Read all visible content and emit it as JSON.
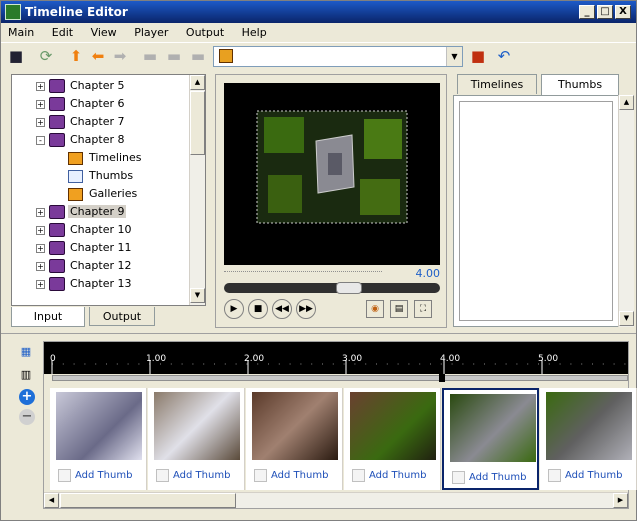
{
  "window": {
    "title": "Timeline Editor",
    "min": "_",
    "max": "□",
    "close": "X"
  },
  "menu": [
    "Main",
    "Edit",
    "View",
    "Player",
    "Output",
    "Help"
  ],
  "tree": {
    "items": [
      {
        "label": "Chapter 5",
        "kind": "chapter",
        "expand": "+"
      },
      {
        "label": "Chapter 6",
        "kind": "chapter",
        "expand": "+"
      },
      {
        "label": "Chapter 7",
        "kind": "chapter",
        "expand": "+"
      },
      {
        "label": "Chapter 8",
        "kind": "chapter",
        "expand": "-"
      },
      {
        "label": "Timelines",
        "kind": "timelines"
      },
      {
        "label": "Thumbs",
        "kind": "thumbs"
      },
      {
        "label": "Galleries",
        "kind": "galleries"
      },
      {
        "label": "Chapter 9",
        "kind": "chapter",
        "expand": "+",
        "selected": true
      },
      {
        "label": "Chapter 10",
        "kind": "chapter",
        "expand": "+"
      },
      {
        "label": "Chapter 11",
        "kind": "chapter",
        "expand": "+"
      },
      {
        "label": "Chapter 12",
        "kind": "chapter",
        "expand": "+"
      },
      {
        "label": "Chapter 13",
        "kind": "chapter",
        "expand": "+"
      }
    ]
  },
  "left_tabs": {
    "input": "Input",
    "output": "Output"
  },
  "right_tabs": {
    "timelines": "Timelines",
    "thumbs": "Thumbs"
  },
  "player": {
    "time": "4.00"
  },
  "ruler": {
    "ticks": [
      "0",
      "1.00",
      "2.00",
      "3.00",
      "4.00",
      "5.00"
    ]
  },
  "thumbs": [
    {
      "label": "Add Thumb",
      "selected": false
    },
    {
      "label": "Add Thumb",
      "selected": false
    },
    {
      "label": "Add Thumb",
      "selected": false
    },
    {
      "label": "Add Thumb",
      "selected": false
    },
    {
      "label": "Add Thumb",
      "selected": true
    },
    {
      "label": "Add Thumb",
      "selected": false
    }
  ],
  "colors": {
    "accent": "#0a246a",
    "link": "#1e4fb8",
    "time": "#1e5fc8"
  }
}
